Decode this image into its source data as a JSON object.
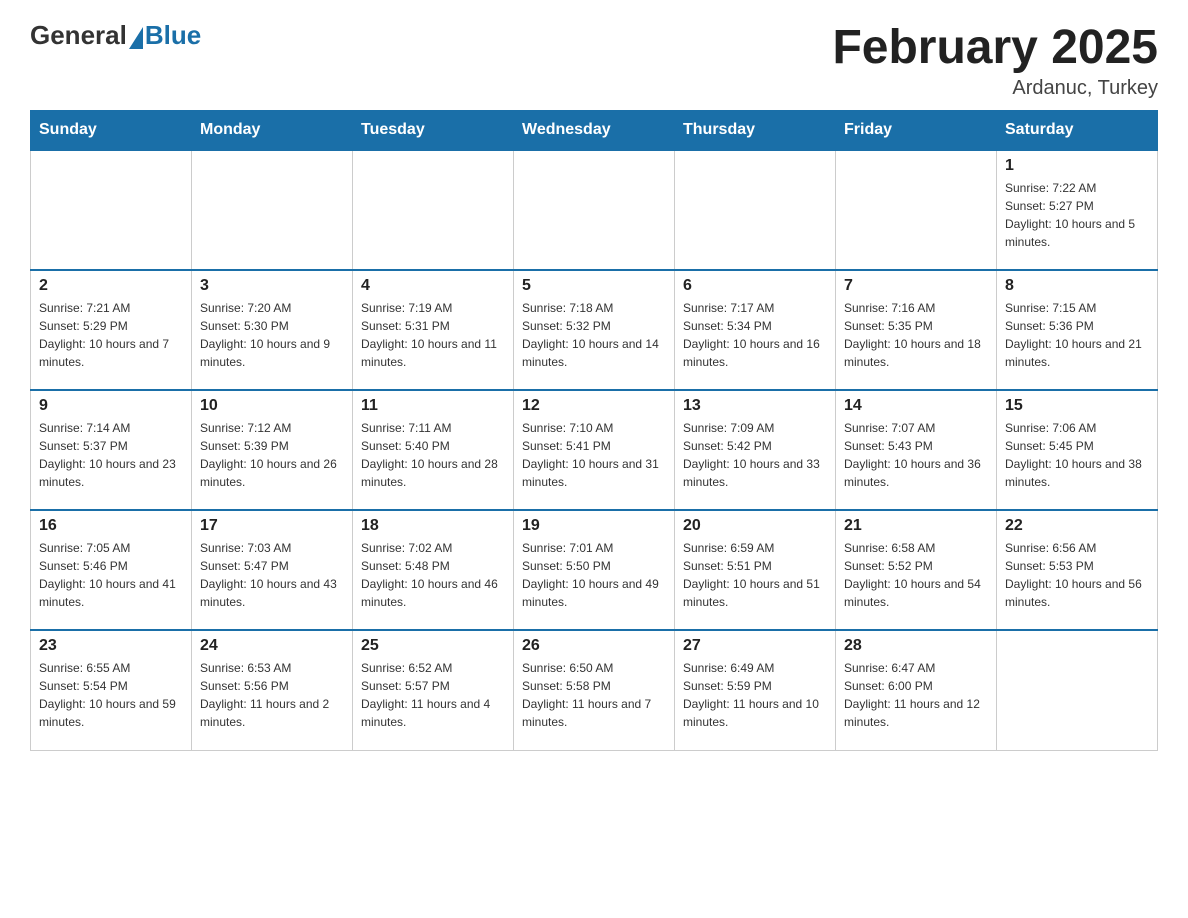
{
  "header": {
    "logo_general": "General",
    "logo_blue": "Blue",
    "month_title": "February 2025",
    "location": "Ardanuc, Turkey"
  },
  "weekdays": [
    "Sunday",
    "Monday",
    "Tuesday",
    "Wednesday",
    "Thursday",
    "Friday",
    "Saturday"
  ],
  "weeks": [
    [
      {
        "day": "",
        "info": ""
      },
      {
        "day": "",
        "info": ""
      },
      {
        "day": "",
        "info": ""
      },
      {
        "day": "",
        "info": ""
      },
      {
        "day": "",
        "info": ""
      },
      {
        "day": "",
        "info": ""
      },
      {
        "day": "1",
        "info": "Sunrise: 7:22 AM\nSunset: 5:27 PM\nDaylight: 10 hours and 5 minutes."
      }
    ],
    [
      {
        "day": "2",
        "info": "Sunrise: 7:21 AM\nSunset: 5:29 PM\nDaylight: 10 hours and 7 minutes."
      },
      {
        "day": "3",
        "info": "Sunrise: 7:20 AM\nSunset: 5:30 PM\nDaylight: 10 hours and 9 minutes."
      },
      {
        "day": "4",
        "info": "Sunrise: 7:19 AM\nSunset: 5:31 PM\nDaylight: 10 hours and 11 minutes."
      },
      {
        "day": "5",
        "info": "Sunrise: 7:18 AM\nSunset: 5:32 PM\nDaylight: 10 hours and 14 minutes."
      },
      {
        "day": "6",
        "info": "Sunrise: 7:17 AM\nSunset: 5:34 PM\nDaylight: 10 hours and 16 minutes."
      },
      {
        "day": "7",
        "info": "Sunrise: 7:16 AM\nSunset: 5:35 PM\nDaylight: 10 hours and 18 minutes."
      },
      {
        "day": "8",
        "info": "Sunrise: 7:15 AM\nSunset: 5:36 PM\nDaylight: 10 hours and 21 minutes."
      }
    ],
    [
      {
        "day": "9",
        "info": "Sunrise: 7:14 AM\nSunset: 5:37 PM\nDaylight: 10 hours and 23 minutes."
      },
      {
        "day": "10",
        "info": "Sunrise: 7:12 AM\nSunset: 5:39 PM\nDaylight: 10 hours and 26 minutes."
      },
      {
        "day": "11",
        "info": "Sunrise: 7:11 AM\nSunset: 5:40 PM\nDaylight: 10 hours and 28 minutes."
      },
      {
        "day": "12",
        "info": "Sunrise: 7:10 AM\nSunset: 5:41 PM\nDaylight: 10 hours and 31 minutes."
      },
      {
        "day": "13",
        "info": "Sunrise: 7:09 AM\nSunset: 5:42 PM\nDaylight: 10 hours and 33 minutes."
      },
      {
        "day": "14",
        "info": "Sunrise: 7:07 AM\nSunset: 5:43 PM\nDaylight: 10 hours and 36 minutes."
      },
      {
        "day": "15",
        "info": "Sunrise: 7:06 AM\nSunset: 5:45 PM\nDaylight: 10 hours and 38 minutes."
      }
    ],
    [
      {
        "day": "16",
        "info": "Sunrise: 7:05 AM\nSunset: 5:46 PM\nDaylight: 10 hours and 41 minutes."
      },
      {
        "day": "17",
        "info": "Sunrise: 7:03 AM\nSunset: 5:47 PM\nDaylight: 10 hours and 43 minutes."
      },
      {
        "day": "18",
        "info": "Sunrise: 7:02 AM\nSunset: 5:48 PM\nDaylight: 10 hours and 46 minutes."
      },
      {
        "day": "19",
        "info": "Sunrise: 7:01 AM\nSunset: 5:50 PM\nDaylight: 10 hours and 49 minutes."
      },
      {
        "day": "20",
        "info": "Sunrise: 6:59 AM\nSunset: 5:51 PM\nDaylight: 10 hours and 51 minutes."
      },
      {
        "day": "21",
        "info": "Sunrise: 6:58 AM\nSunset: 5:52 PM\nDaylight: 10 hours and 54 minutes."
      },
      {
        "day": "22",
        "info": "Sunrise: 6:56 AM\nSunset: 5:53 PM\nDaylight: 10 hours and 56 minutes."
      }
    ],
    [
      {
        "day": "23",
        "info": "Sunrise: 6:55 AM\nSunset: 5:54 PM\nDaylight: 10 hours and 59 minutes."
      },
      {
        "day": "24",
        "info": "Sunrise: 6:53 AM\nSunset: 5:56 PM\nDaylight: 11 hours and 2 minutes."
      },
      {
        "day": "25",
        "info": "Sunrise: 6:52 AM\nSunset: 5:57 PM\nDaylight: 11 hours and 4 minutes."
      },
      {
        "day": "26",
        "info": "Sunrise: 6:50 AM\nSunset: 5:58 PM\nDaylight: 11 hours and 7 minutes."
      },
      {
        "day": "27",
        "info": "Sunrise: 6:49 AM\nSunset: 5:59 PM\nDaylight: 11 hours and 10 minutes."
      },
      {
        "day": "28",
        "info": "Sunrise: 6:47 AM\nSunset: 6:00 PM\nDaylight: 11 hours and 12 minutes."
      },
      {
        "day": "",
        "info": ""
      }
    ]
  ]
}
